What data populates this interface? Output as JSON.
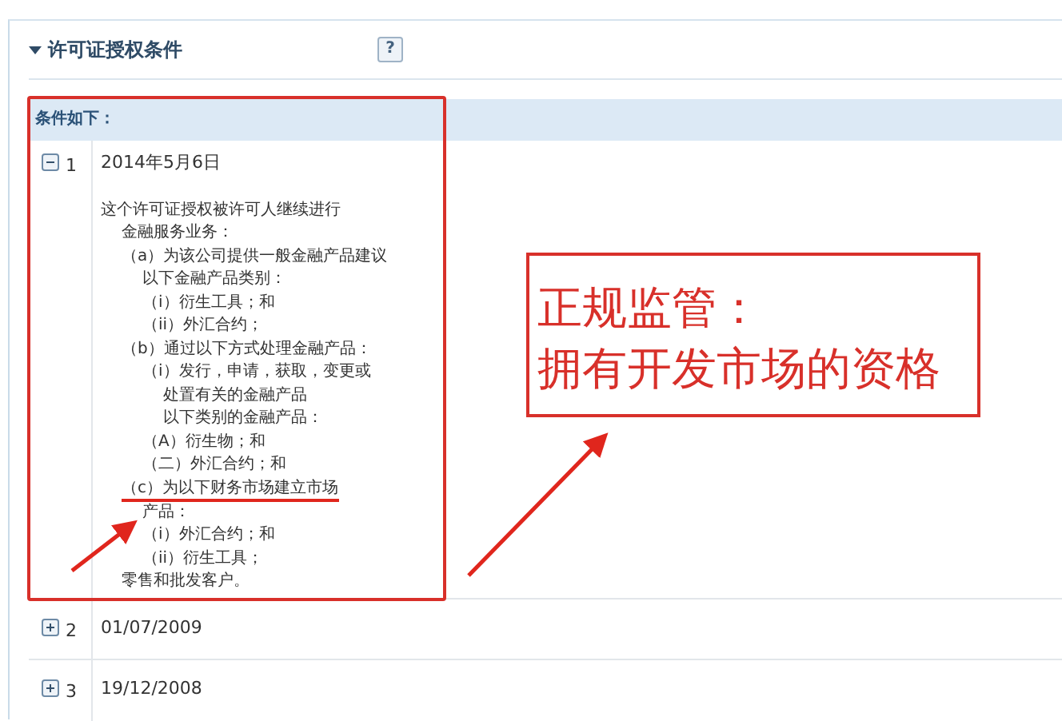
{
  "panel": {
    "title": "许可证授权条件",
    "expanded": true,
    "help_label": "?"
  },
  "table": {
    "header": "条件如下：",
    "rows": [
      {
        "number": "1",
        "expanded": true,
        "date": "2014年5月6日",
        "lines": [
          {
            "text": "这个许可证授权被许可人继续进行",
            "underlined": false,
            "children": [
              {
                "text": "金融服务业务：",
                "underlined": false
              },
              {
                "text": "（a）为该公司提供一般金融产品建议",
                "underlined": false,
                "children": [
                  {
                    "text": "以下金融产品类别：",
                    "underlined": false
                  },
                  {
                    "text": "（i）衍生工具；和",
                    "underlined": false
                  },
                  {
                    "text": "（ii）外汇合约；",
                    "underlined": false
                  }
                ]
              },
              {
                "text": "（b）通过以下方式处理金融产品：",
                "underlined": false,
                "children": [
                  {
                    "text": "（i）发行，申请，获取，变更或",
                    "underlined": false,
                    "children": [
                      {
                        "text": "处置有关的金融产品",
                        "underlined": false
                      },
                      {
                        "text": "以下类别的金融产品：",
                        "underlined": false
                      }
                    ]
                  },
                  {
                    "text": "（A）衍生物；和",
                    "underlined": false
                  },
                  {
                    "text": "（二）外汇合约；和",
                    "underlined": false
                  }
                ]
              },
              {
                "text": "（c）为以下财务市场建立市场",
                "underlined": true,
                "children": [
                  {
                    "text": "产品：",
                    "underlined": false
                  },
                  {
                    "text": "（i）外汇合约；和",
                    "underlined": false
                  },
                  {
                    "text": "（ii）衍生工具；",
                    "underlined": false
                  }
                ]
              },
              {
                "text": "零售和批发客户。",
                "underlined": false
              }
            ]
          }
        ]
      },
      {
        "number": "2",
        "expanded": false,
        "date": "01/07/2009"
      },
      {
        "number": "3",
        "expanded": false,
        "date": "19/12/2008"
      }
    ]
  },
  "annotation": {
    "lines": [
      "正规监管：",
      "拥有开发市场的资格"
    ]
  }
}
